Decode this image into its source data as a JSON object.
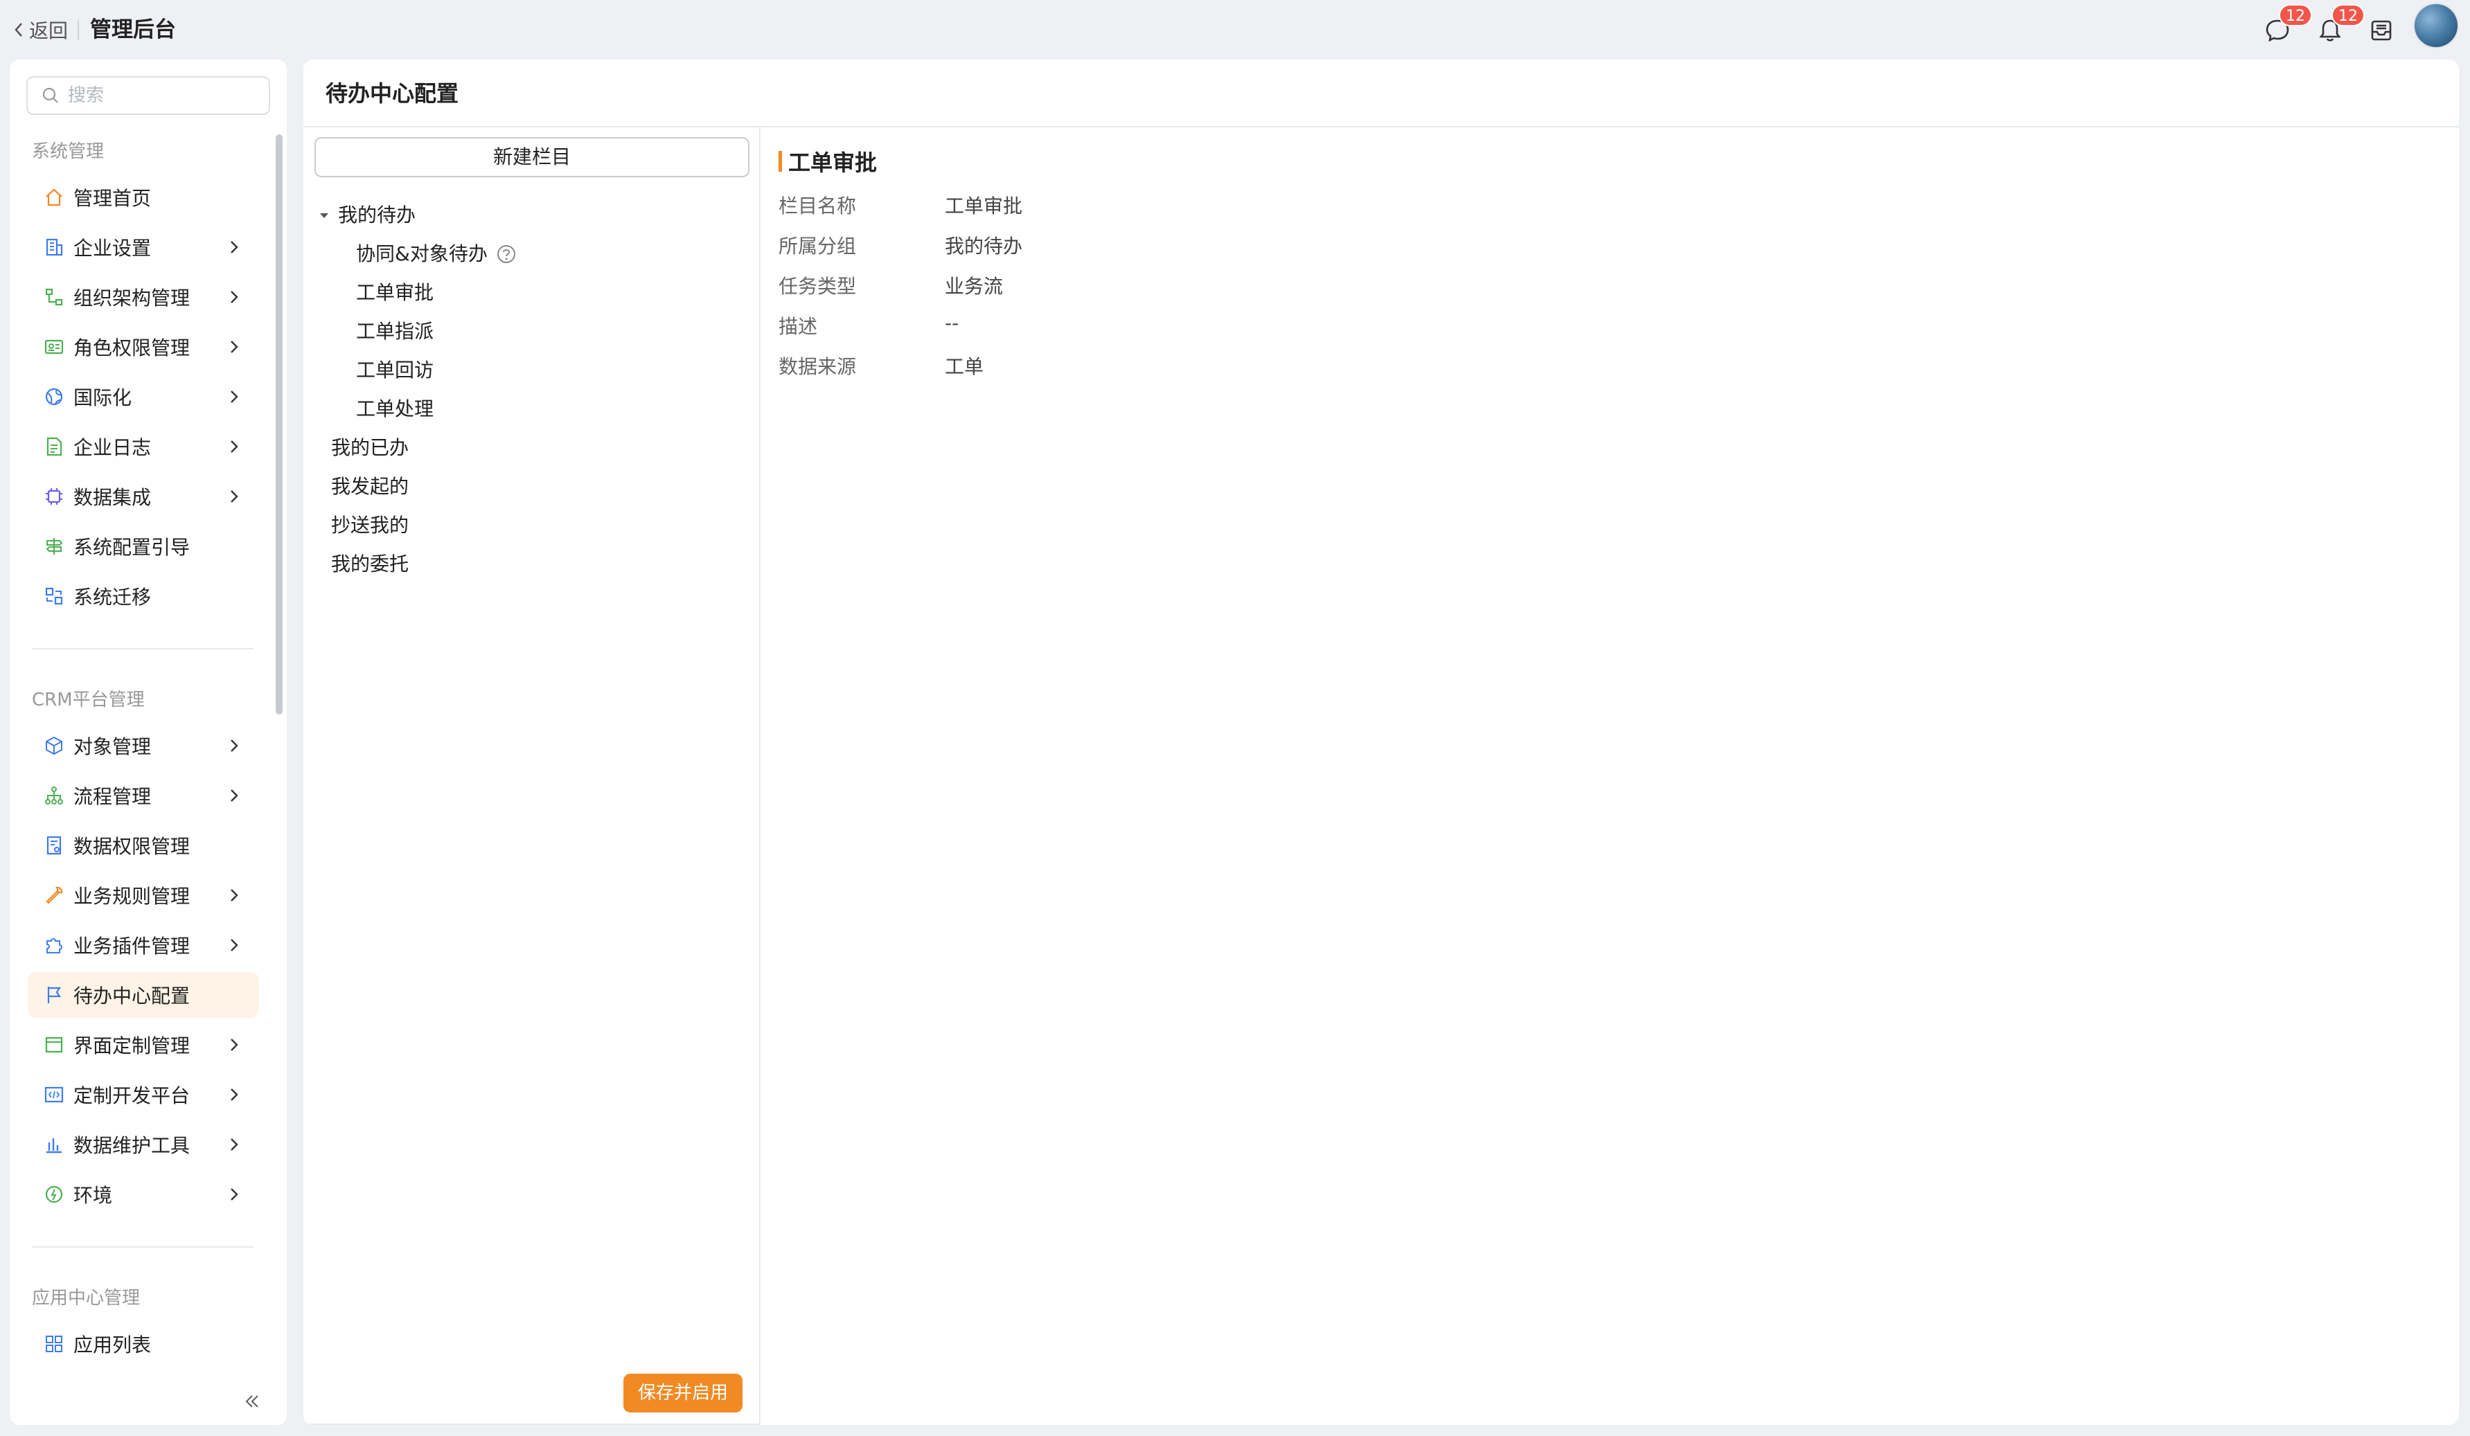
{
  "topbar": {
    "back_label": "返回",
    "app_title": "管理后台",
    "message_badge": "12",
    "notification_badge": "12"
  },
  "sidebar": {
    "search_placeholder": "搜索",
    "sections": [
      {
        "title": "系统管理",
        "items": [
          {
            "label": "管理首页",
            "icon": "home-icon",
            "chevron": false
          },
          {
            "label": "企业设置",
            "icon": "building-icon",
            "chevron": true
          },
          {
            "label": "组织架构管理",
            "icon": "org-chart-icon",
            "chevron": true
          },
          {
            "label": "角色权限管理",
            "icon": "id-card-icon",
            "chevron": true
          },
          {
            "label": "国际化",
            "icon": "globe-icon",
            "chevron": true
          },
          {
            "label": "企业日志",
            "icon": "log-icon",
            "chevron": true
          },
          {
            "label": "数据集成",
            "icon": "chip-icon",
            "chevron": true
          },
          {
            "label": "系统配置引导",
            "icon": "signpost-icon",
            "chevron": false
          },
          {
            "label": "系统迁移",
            "icon": "migrate-icon",
            "chevron": false
          }
        ]
      },
      {
        "title": "CRM平台管理",
        "items": [
          {
            "label": "对象管理",
            "icon": "cube-icon",
            "chevron": true
          },
          {
            "label": "流程管理",
            "icon": "flow-icon",
            "chevron": true
          },
          {
            "label": "数据权限管理",
            "icon": "data-lock-icon",
            "chevron": false
          },
          {
            "label": "业务规则管理",
            "icon": "wrench-icon",
            "chevron": true
          },
          {
            "label": "业务插件管理",
            "icon": "puzzle-icon",
            "chevron": true
          },
          {
            "label": "待办中心配置",
            "icon": "flag-icon",
            "chevron": false,
            "active": true
          },
          {
            "label": "界面定制管理",
            "icon": "layout-icon",
            "chevron": true
          },
          {
            "label": "定制开发平台",
            "icon": "code-icon",
            "chevron": true
          },
          {
            "label": "数据维护工具",
            "icon": "bar-chart-icon",
            "chevron": true
          },
          {
            "label": "环境",
            "icon": "environment-icon",
            "chevron": true
          }
        ]
      },
      {
        "title": "应用中心管理",
        "items": [
          {
            "label": "应用列表",
            "icon": "grid-icon",
            "chevron": false
          }
        ]
      }
    ]
  },
  "main": {
    "title": "待办中心配置",
    "new_button": "新建栏目",
    "tree": [
      {
        "label": "我的待办",
        "expanded": true
      },
      {
        "label": "协同&对象待办",
        "help": true
      },
      {
        "label": "工单审批"
      },
      {
        "label": "工单指派"
      },
      {
        "label": "工单回访"
      },
      {
        "label": "工单处理"
      },
      {
        "label": "我的已办"
      },
      {
        "label": "我发起的"
      },
      {
        "label": "抄送我的"
      },
      {
        "label": "我的委托"
      }
    ],
    "save_button": "保存并启用",
    "detail": {
      "title": "工单审批",
      "fields": [
        {
          "label": "栏目名称",
          "value": "工单审批"
        },
        {
          "label": "所属分组",
          "value": "我的待办"
        },
        {
          "label": "任务类型",
          "value": "业务流"
        },
        {
          "label": "描述",
          "value": "--"
        },
        {
          "label": "数据来源",
          "value": "工单"
        }
      ]
    }
  },
  "colors": {
    "accent": "#f28a24",
    "badge": "#f2554a",
    "active_bg": "#fdf3e6"
  }
}
